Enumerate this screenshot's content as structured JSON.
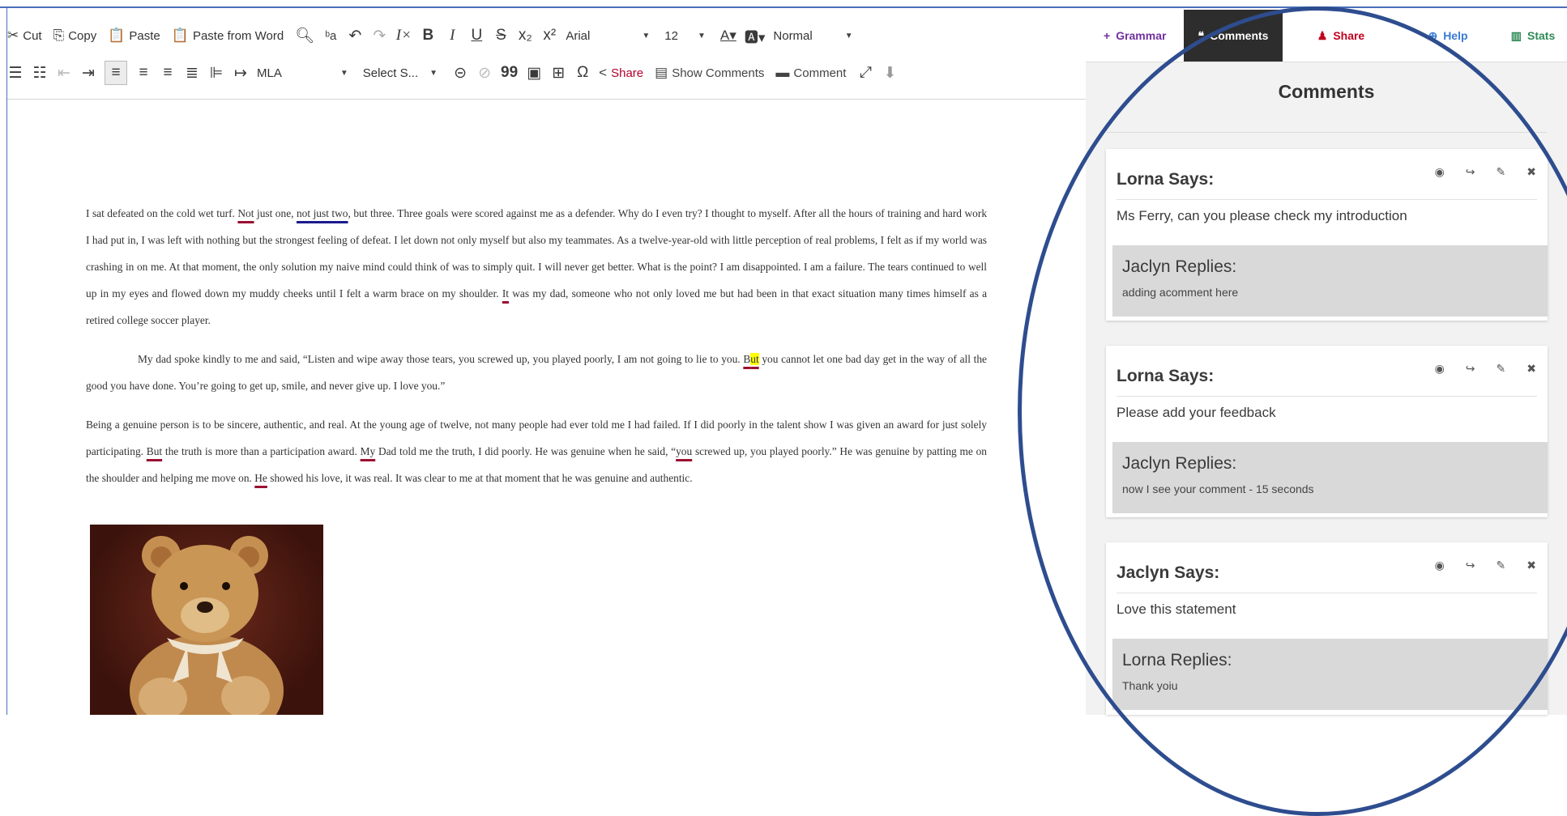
{
  "toolbar": {
    "row1": {
      "cut": "Cut",
      "copy": "Copy",
      "paste": "Paste",
      "paste_word": "Paste from Word",
      "font": "Arial",
      "size": "12",
      "style": "Normal"
    },
    "row2": {
      "citation": "MLA",
      "select_style": "Select S...",
      "share": "Share",
      "show_comments": "Show Comments",
      "comment": "Comment"
    }
  },
  "document": {
    "p1": {
      "a": "I sat defeated on the cold wet turf. ",
      "u1": "Not",
      "b": " just one, ",
      "u2": "not just two",
      "c": ", but three. Three goals were scored against me as a defender. Why do I even try? I thought to myself. After all the hours of training and hard work I had put in, I was left with nothing but the strongest feeling of defeat. I let down not only myself but also my teammates. As a twelve-year-old with little perception of real problems, I felt as if my world was crashing in on me. At that moment, the only solution my naive mind could think of was to simply quit. I will never get better. What is the point? I am disappointed. I am a failure. The tears continued to well up in my eyes and flowed down my muddy cheeks until I felt a warm brace on my shoulder. ",
      "u3": "It",
      "d": " was my dad, someone who not only loved me but had been in that exact situation many times himself as a retired college soccer player."
    },
    "p2": {
      "a": "My dad spoke kindly to me and said, “Listen and wipe away those tears, you screwed up, you played poorly, I am not going to lie to you. ",
      "u1": "B",
      "h1": "ut",
      "b": " you cannot let one bad day get in the way of all the good you have done. You’re going to get up, smile, and never give up. I love you.”"
    },
    "p3": {
      "a": "Being a genuine person is to be sincere, authentic, and real. At the young age of twelve, not many people had ever told me I had failed. If I did poorly in the talent show I was given an award for just solely participating. ",
      "u1": "But",
      "b": " the truth is more than a participation award. ",
      "u2": "My",
      "c": " Dad told me the truth, I did poorly. He was genuine when he said, “",
      "u3": "you",
      "d": " screwed up, you played poorly.” He was genuine by patting me on the shoulder and helping me move on. ",
      "u4": "He",
      "e": " showed his love, it was real. It was clear to me at that moment that he was genuine and authentic."
    }
  },
  "panel": {
    "tabs": {
      "grammar": "Grammar",
      "comments": "Comments",
      "share": "Share",
      "help": "Help",
      "stats": "Stats"
    },
    "title": "Comments",
    "comments": [
      {
        "author": "Lorna Says:",
        "text": "Ms Ferry, can you please check my introduction",
        "reply_author": "Jaclyn Replies:",
        "reply_text": "adding acomment here"
      },
      {
        "author": "Lorna Says:",
        "text": "Please add your feedback",
        "reply_author": "Jaclyn Replies:",
        "reply_text": "now I see your comment - 15 seconds"
      },
      {
        "author": "Jaclyn Says:",
        "text": "Love this statement",
        "reply_author": "Lorna Replies:",
        "reply_text": "Thank yoiu"
      }
    ]
  },
  "colors": {
    "annotation_ellipse": "#2e4d8f",
    "underline_red": "#9b1030",
    "underline_blue": "#1a1a8c",
    "highlight": "#ffff00",
    "active_tab": "#2d2d2d"
  }
}
